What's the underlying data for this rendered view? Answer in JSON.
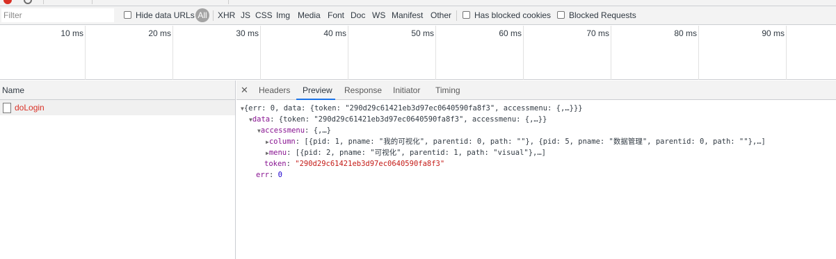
{
  "filter": {
    "placeholder": "Filter"
  },
  "filter_options": {
    "hide_data_urls": "Hide data URLs",
    "all": "All",
    "types": [
      "XHR",
      "JS",
      "CSS",
      "Img",
      "Media",
      "Font",
      "Doc",
      "WS",
      "Manifest",
      "Other"
    ],
    "has_blocked_cookies": "Has blocked cookies",
    "blocked_requests": "Blocked Requests"
  },
  "timeline": {
    "ticks": [
      "10 ms",
      "20 ms",
      "30 ms",
      "40 ms",
      "50 ms",
      "60 ms",
      "70 ms",
      "80 ms",
      "90 ms"
    ]
  },
  "requests": {
    "column_header": "Name",
    "items": [
      {
        "name": "doLogin"
      }
    ]
  },
  "detail": {
    "tabs": [
      "Headers",
      "Preview",
      "Response",
      "Initiator",
      "Timing"
    ],
    "active_tab": "Preview",
    "preview": {
      "line1": "{err: 0, data: {token: \"290d29c61421eb3d97ec0640590fa8f3\", accessmenu: {,…}}}",
      "line2_key": "data",
      "line2_val": "{token: \"290d29c61421eb3d97ec0640590fa8f3\", accessmenu: {,…}}",
      "line3_key": "accessmenu",
      "line3_val": "{,…}",
      "line4_key": "column",
      "line4_val": "[{pid: 1, pname: \"我的可视化\", parentid: 0, path: \"\"}, {pid: 5, pname: \"数据管理\", parentid: 0, path: \"\"},…]",
      "line5_key": "menu",
      "line5_val": "[{pid: 2, pname: \"可视化\", parentid: 1, path: \"visual\"},…]",
      "line6_key": "token",
      "line6_val": "\"290d29c61421eb3d97ec0640590fa8f3\"",
      "line7_key": "err",
      "line7_val": "0"
    }
  },
  "colors": {
    "accent": "#1a73e8",
    "request_name": "#d93025",
    "json_key": "#881391",
    "json_string": "#c41a16"
  }
}
